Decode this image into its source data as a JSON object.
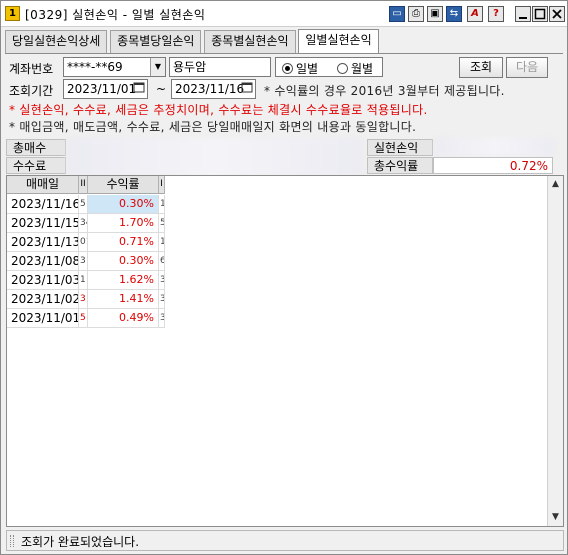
{
  "window": {
    "app_icon": "1",
    "title": "[0329] 실현손익 - 일별 실현손익",
    "title_buttons": [
      "link-icon",
      "print-icon",
      "window-icon",
      "pin-icon",
      "font-icon",
      "help-icon"
    ],
    "minimize_icon": "minimize-icon",
    "maximize_icon": "maximize-icon",
    "close_icon": "close-icon"
  },
  "tabs": [
    {
      "label": "당일실현손익상세",
      "active": false
    },
    {
      "label": "종목별당일손익",
      "active": false
    },
    {
      "label": "종목별실현손익",
      "active": false
    },
    {
      "label": "일별실현손익",
      "active": true
    }
  ],
  "form": {
    "account_label": "계좌번호",
    "account_value": "****-**69",
    "account_name": "용두암",
    "period_label": "조회기간",
    "date_from": "2023/11/01",
    "date_to": "2023/11/16",
    "tilde": "~",
    "radio_daily": "일별",
    "radio_monthly": "월별",
    "daily_selected": true,
    "search_button": "조회",
    "next_button": "다음",
    "rate_notice": "* 수익률의 경우 2016년 3월부터 제공됩니다."
  },
  "notes": {
    "red": "* 실현손익, 수수료, 세금은 추정치이며, 수수료는 체결시 수수료율로 적용됩니다.",
    "info": "* 매입금액, 매도금액, 수수료, 세금은 당일매매일지 화면의 내용과 동일합니다."
  },
  "summary": {
    "total_buy_label": "총매수",
    "fee_label": "수수료",
    "realized_label": "실현손익",
    "total_rate_label": "총수익률",
    "total_rate_value": "0.72%"
  },
  "grid": {
    "headers": [
      "매매일",
      "II",
      "수익률",
      "I"
    ],
    "rows": [
      {
        "date": "2023/11/16",
        "cut1": "5",
        "rate": "0.30%",
        "cut2": "1",
        "selected": true
      },
      {
        "date": "2023/11/15",
        "cut1": "34",
        "rate": "1.70%",
        "cut2": "5"
      },
      {
        "date": "2023/11/13",
        "cut1": "01",
        "rate": "0.71%",
        "cut2": "1"
      },
      {
        "date": "2023/11/08",
        "cut1": "3",
        "rate": "0.30%",
        "cut2": "6"
      },
      {
        "date": "2023/11/03",
        "cut1": "1",
        "rate": "1.62%",
        "cut2": "3"
      },
      {
        "date": "2023/11/02",
        "cut1": "3",
        "rate": "1.41%",
        "cut2": "3"
      },
      {
        "date": "2023/11/01",
        "cut1": "5",
        "rate": "0.49%",
        "cut2": "3"
      }
    ]
  },
  "status": {
    "message": "조회가 완료되었습니다."
  }
}
